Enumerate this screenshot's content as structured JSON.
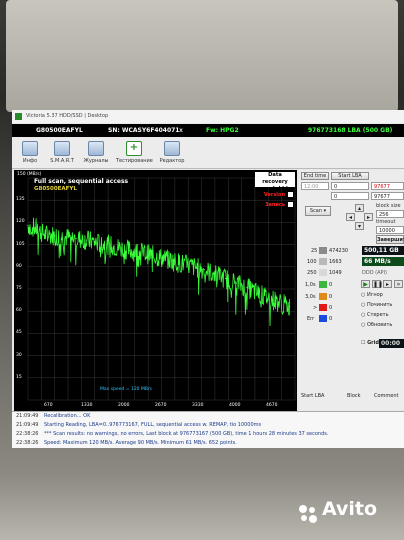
{
  "window": {
    "title": "Victoria 5.37 HDD/SSD | Desktop"
  },
  "drive_info": {
    "model": "G80500EAFYL",
    "serial": "SN: WCASY6F404071",
    "close": "x",
    "firmware": "Fw: HPG2",
    "capacity": "976773168 LBA (500 GB)"
  },
  "toolbar": {
    "tabs": [
      {
        "label": "Инфо",
        "icon": "info-icon"
      },
      {
        "label": "S.M.A.R.T",
        "icon": "smart-icon"
      },
      {
        "label": "Журналы",
        "icon": "logs-icon"
      },
      {
        "label": "Тестирование",
        "icon": "test-icon",
        "active": true
      },
      {
        "label": "Редактор",
        "icon": "editor-icon"
      }
    ]
  },
  "graph": {
    "y_top": "150 (MB/s)",
    "title": "Full scan, sequential access",
    "subtitle": "G80500EAFYL",
    "watermark_line1": "Data recovery",
    "watermark_line2": "www.hdd.by",
    "version_label": "Version",
    "record_label": "Запись",
    "max_speed": "Max speed = 120 MB/s",
    "accent_color": "#39ff3a"
  },
  "chart_data": {
    "type": "line",
    "x_ticks": [
      "670",
      "1330",
      "2000",
      "2670",
      "3330",
      "4000",
      "4670"
    ],
    "y_ticks": [
      "150 (MB/s)",
      "135",
      "120",
      "105",
      "90",
      "75",
      "60",
      "45",
      "30",
      "15"
    ],
    "ylim": [
      0,
      150
    ],
    "xlim": [
      0,
      5000
    ],
    "grid": true,
    "series": [
      {
        "values_x": [
          0,
          150,
          300,
          500,
          700,
          900,
          1100,
          1300,
          1500,
          1700,
          1900,
          2100,
          2300,
          2500,
          2700,
          2900,
          3100,
          3300,
          3500,
          3700,
          3900,
          4100,
          4300,
          4500,
          4700,
          4900
        ],
        "values_y": [
          118,
          116,
          112,
          111,
          110,
          109,
          108,
          106,
          105,
          103,
          101,
          100,
          98,
          96,
          94,
          92,
          90,
          88,
          85,
          82,
          79,
          76,
          72,
          69,
          66,
          63
        ]
      }
    ]
  },
  "scan_panel": {
    "end_time_label": "End time",
    "start_lba_label": "Start LBA",
    "time_value": "12:00",
    "start_lba_value": "0",
    "end_lba_value": "97677",
    "field2": "0",
    "field3": "97677",
    "scan_button": "Scan",
    "continue_button": "Завершить",
    "block_size_label": "block size",
    "block_size_value": "256",
    "timeout_label": "timeout",
    "timeout_value": "10000",
    "count_25": "474230",
    "speed_value": "500,11 GB",
    "count_100": "1663",
    "speed_mbs": "66 MB/s",
    "count_250": "1049",
    "ddd_label": "DDD (API)",
    "count_1s": "0",
    "count_3s": "0",
    "count_10s": "0",
    "err_label": "Err",
    "err_value": "0",
    "label_25": "25",
    "label_100": "100",
    "label_250": "250",
    "label_1s": "1,0s",
    "label_3s": "3,0s",
    "label_10s": ">",
    "ignore_label": "Игнор",
    "repair_label": "Починить",
    "erase_label": "Стереть",
    "refresh_label": "Обновить",
    "grid_label": "Grid",
    "grid_value": "00:00",
    "col_start": "Start LBA",
    "col_block": "Block",
    "col_comment": "Comment"
  },
  "log": [
    {
      "time": "21:09:49",
      "message": "Recalibration... OK"
    },
    {
      "time": "21:09:49",
      "message": "Starting Reading, LBA=0..976773167, FULL, sequential access w. REMAP, tio 10000ms"
    },
    {
      "time": "22:38:26",
      "message": "*** Scan results: no warnings, no errors, Last block at 976773167 (500 GB), time 1 hours 28 minutes 37 seconds."
    },
    {
      "time": "22:38:26",
      "message": "Speed: Maximum 120 MB/s. Average 90 MB/s. Minimum 61 MB/s. 652 points."
    }
  ],
  "overlay": {
    "avito": "Avito"
  }
}
